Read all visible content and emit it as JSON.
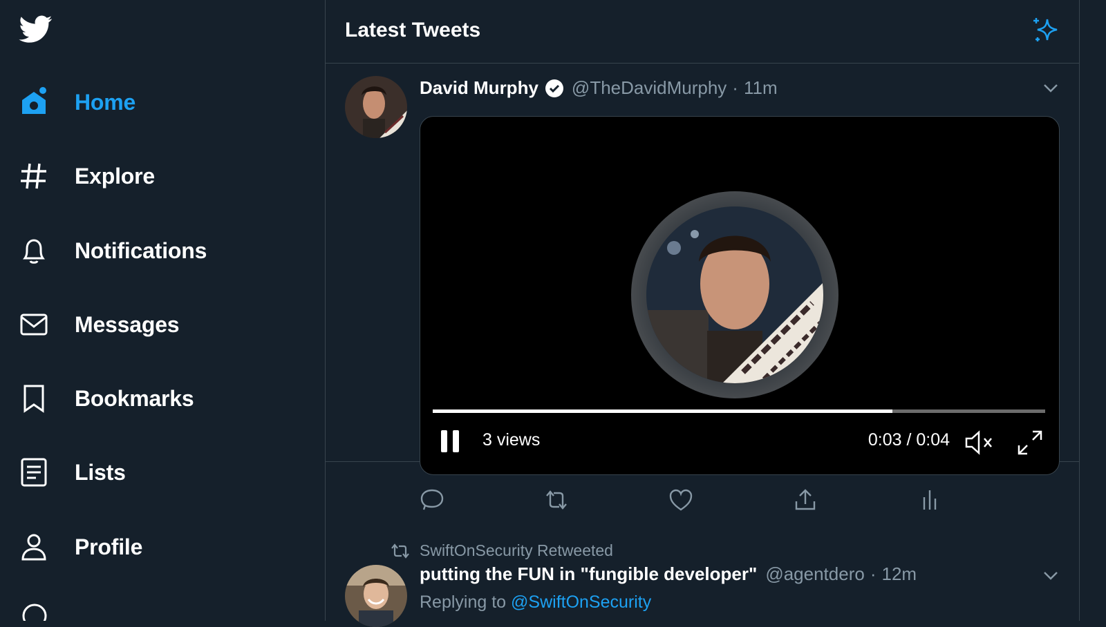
{
  "sidebar": {
    "logo_icon": "twitter-bird-icon",
    "items": [
      {
        "label": "Home",
        "icon": "home-icon",
        "active": true
      },
      {
        "label": "Explore",
        "icon": "hashtag-icon"
      },
      {
        "label": "Notifications",
        "icon": "bell-icon"
      },
      {
        "label": "Messages",
        "icon": "envelope-icon"
      },
      {
        "label": "Bookmarks",
        "icon": "bookmark-icon"
      },
      {
        "label": "Lists",
        "icon": "list-icon"
      },
      {
        "label": "Profile",
        "icon": "person-icon"
      }
    ]
  },
  "header": {
    "title": "Latest Tweets",
    "action_icon": "sparkle-icon"
  },
  "tweets": [
    {
      "name": "David Murphy",
      "verified": true,
      "handle": "@TheDavidMurphy",
      "time": "11m",
      "video": {
        "views": "3 views",
        "time": "0:03 / 0:04",
        "progress": 0.75,
        "muted": true
      },
      "actions": [
        "reply-icon",
        "retweet-icon",
        "like-icon",
        "share-icon",
        "analytics-icon"
      ]
    },
    {
      "retweeted_by": "SwiftOnSecurity Retweeted",
      "name": "putting the FUN in \"fungible developer\"",
      "handle": "@agentdero",
      "time": "12m",
      "reply_prefix": "Replying to",
      "reply_to": "@SwiftOnSecurity"
    }
  ],
  "colors": {
    "background": "#15202b",
    "accent": "#1da1f2",
    "muted": "#8899a6",
    "border": "#38444d"
  }
}
